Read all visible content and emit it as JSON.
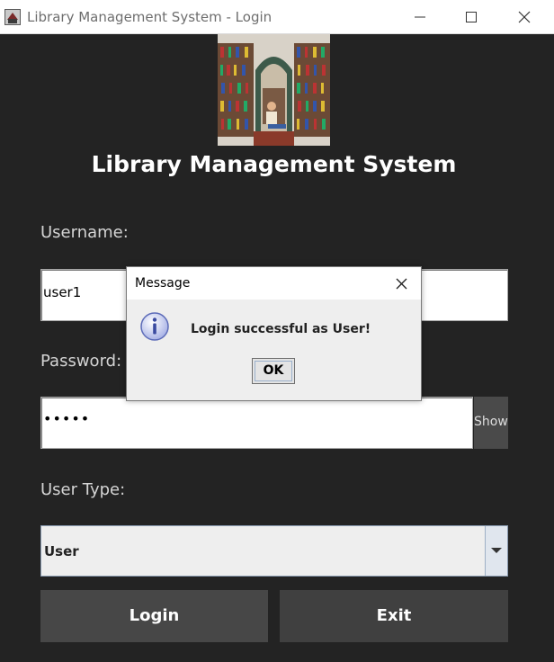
{
  "window": {
    "title": "Library Management System - Login",
    "icon": "book-app-icon"
  },
  "app": {
    "heading": "Library Management System",
    "header_image": "library-bookshelves-photo"
  },
  "form": {
    "username_label": "Username:",
    "username_value": "user1",
    "password_label": "Password:",
    "password_value": "•••••",
    "show_label": "Show",
    "usertype_label": "User Type:",
    "usertype_value": "User"
  },
  "buttons": {
    "login": "Login",
    "exit": "Exit"
  },
  "dialog": {
    "title": "Message",
    "message": "Login successful as User!",
    "ok": "OK",
    "icon": "info-icon"
  },
  "colors": {
    "background": "#232323",
    "button": "#474747",
    "dialog": "#eeeeee"
  }
}
